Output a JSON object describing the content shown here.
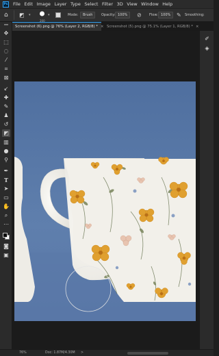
{
  "menubar": {
    "logo": "Ps",
    "items": [
      "File",
      "Edit",
      "Image",
      "Layer",
      "Type",
      "Select",
      "Filter",
      "3D",
      "View",
      "Window",
      "Help"
    ]
  },
  "options": {
    "brush_size": "200",
    "mode_label": "Mode:",
    "mode_value": "Brush",
    "opacity_label": "Opacity:",
    "opacity_value": "100%",
    "flow_label": "Flow:",
    "flow_value": "100%",
    "smoothing_label": "Smoothing:"
  },
  "tabs": [
    {
      "label": "Screenshot (6).png @ 76% (Layer 2, RGB/8) *",
      "close": "×"
    },
    {
      "label": "Screenshot (5).png @ 75.1% (Layer 1, RGB/8) *",
      "close": "×"
    }
  ],
  "statusbar": {
    "zoom": "76%",
    "doc": "Doc: 1.87M/4.30M",
    "arrow": ">"
  },
  "colors": {
    "accent": "#31a8ff",
    "background_blue": "#5a7aa8",
    "cup": "#f3f1ec",
    "flower_orange": "#e0a030"
  },
  "icons": {
    "tools": [
      "move-icon",
      "marquee-icon",
      "lasso-icon",
      "magic-wand-icon",
      "crop-icon",
      "frame-icon",
      "eyedropper-icon",
      "healing-icon",
      "brush-icon",
      "clone-stamp-icon",
      "history-brush-icon",
      "eraser-icon",
      "gradient-icon",
      "blur-icon",
      "dodge-icon",
      "pen-icon",
      "type-icon",
      "path-select-icon",
      "shape-icon",
      "hand-icon",
      "zoom-icon",
      "more-tools-icon"
    ],
    "panel": [
      "brush-panel-icon",
      "layers-panel-icon"
    ]
  }
}
